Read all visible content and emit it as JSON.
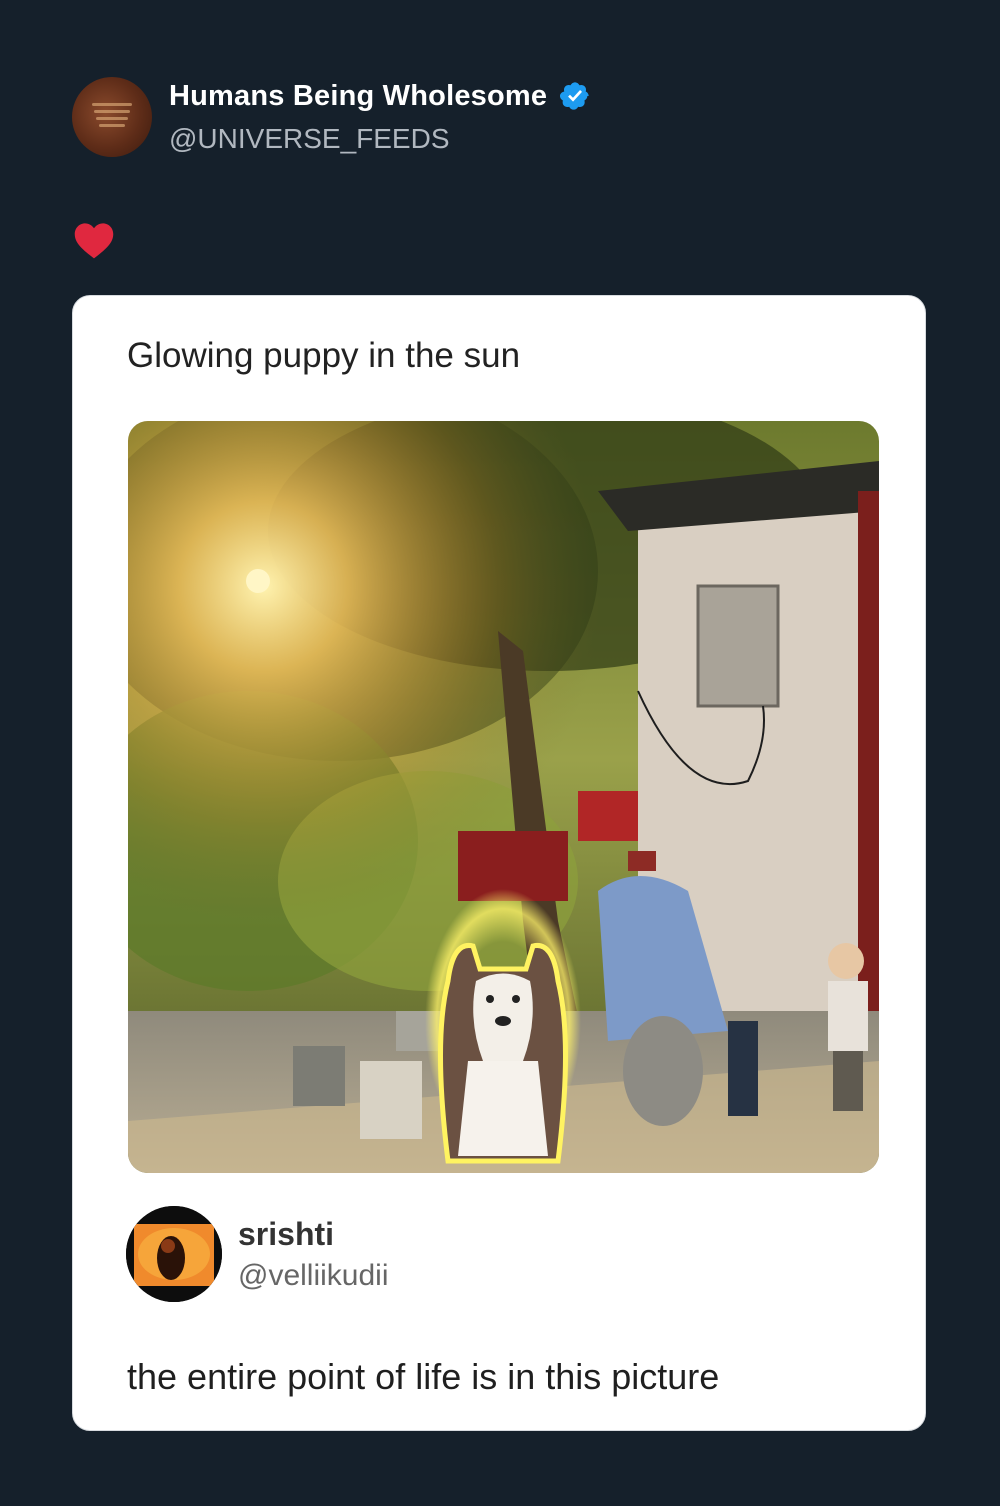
{
  "post": {
    "author": {
      "display_name": "Humans Being Wholesome",
      "handle": "@UNIVERSE_FEEDS",
      "verified": true,
      "avatar_icon": "avatar-image"
    },
    "reaction_icon": "heart-icon",
    "colors": {
      "background": "#15202b",
      "verified_badge": "#1d9bf0",
      "heart": "#e0283f"
    }
  },
  "embed": {
    "caption": "Glowing puppy in the sun",
    "image_alt": "Dog glowing in sunlight",
    "reply": {
      "display_name": "srishti",
      "handle": "@velliikudii",
      "avatar_icon": "avatar-image"
    },
    "text": "the entire point of life is in this picture"
  }
}
